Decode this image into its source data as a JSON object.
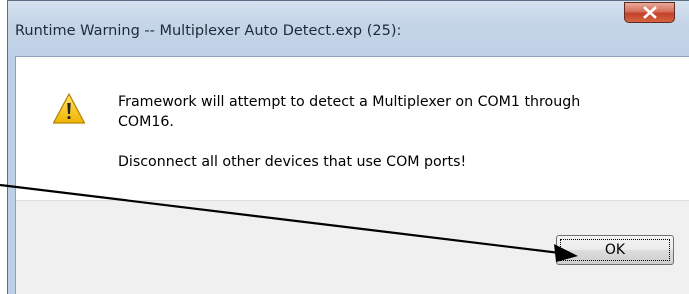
{
  "window": {
    "title": "Runtime Warning -- Multiplexer Auto Detect.exp (25):",
    "close_icon": "close-x-icon"
  },
  "dialog": {
    "icon": "warning-triangle-icon",
    "message_line1": "Framework will attempt to detect a Multiplexer on COM1 through COM16.",
    "message_line2": "Disconnect all other devices that use COM ports!",
    "ok_label": "OK"
  },
  "annotation": {
    "arrow_icon": "pointer-arrow-annotation"
  },
  "colors": {
    "titlebar": "#c6d6e8",
    "close_button": "#c2412c",
    "content_bg": "#ffffff",
    "button_area_bg": "#f0f0f0",
    "warning_yellow": "#f5c400"
  }
}
